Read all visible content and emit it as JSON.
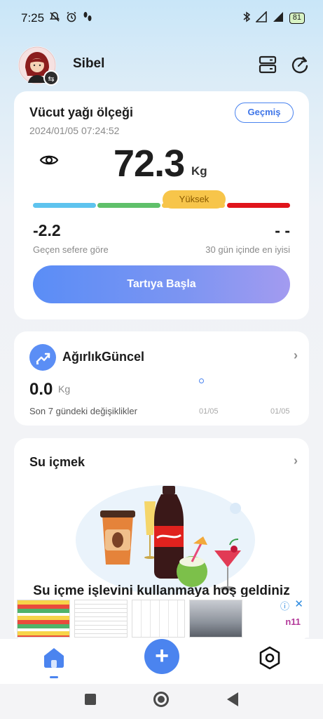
{
  "status_bar": {
    "time": "7:25",
    "battery": "81",
    "left_icons": [
      "notifications-off-icon",
      "alarm-icon",
      "walk-icon"
    ],
    "right_icons": [
      "bluetooth-icon",
      "signal-icon",
      "wifi-icon",
      "battery-icon"
    ]
  },
  "header": {
    "username": "Sibel",
    "icons": [
      "switch-user-icon",
      "device-list-icon",
      "sync-icon"
    ]
  },
  "scale_card": {
    "title": "Vücut yağı ölçeği",
    "datetime": "2024/01/05 07:24:52",
    "history_label": "Geçmiş",
    "weight_value": "72.3",
    "weight_unit": "Kg",
    "level_label": "Yüksek",
    "level_colors": [
      "#5ec3ee",
      "#5fc06a",
      "#f7c54a",
      "#e0141b"
    ],
    "delta_value": "-2.2",
    "delta_label": "Geçen sefere göre",
    "best_value": "- -",
    "best_label": "30 gün içinde en iyisi",
    "start_label": "Tartıya Başla"
  },
  "weight_card": {
    "title": "AğırlıkGüncel",
    "value": "0.0",
    "unit": "Kg",
    "caption": "Son 7 gündeki değişiklikler",
    "dates": [
      "01/05",
      "01/05"
    ]
  },
  "water_card": {
    "title": "Su içmek",
    "welcome": "Su içme işlevini kullanmaya hoş geldiniz"
  },
  "ad": {
    "info_icon": "info-icon",
    "close_icon": "close-icon",
    "brand": "n11"
  },
  "bottom_nav": {
    "items": [
      "home-icon",
      "add-icon",
      "settings-icon"
    ],
    "add_symbol": "+"
  },
  "accent_color": "#4b84ef"
}
